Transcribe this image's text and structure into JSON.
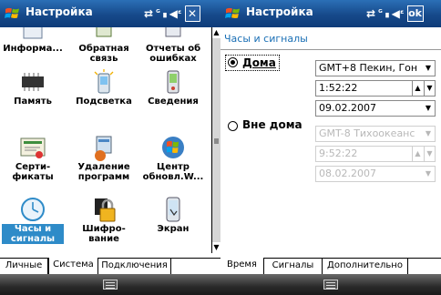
{
  "left": {
    "title": "Настройка",
    "items": [
      {
        "label": "Информа...",
        "icon": "info-icon"
      },
      {
        "label": "Обратная связь",
        "icon": "feedback-icon"
      },
      {
        "label": "Отчеты об ошибках",
        "icon": "error-report-icon"
      },
      {
        "label": "Память",
        "icon": "memory-chip-icon"
      },
      {
        "label": "Подсветка",
        "icon": "backlight-icon"
      },
      {
        "label": "Сведения",
        "icon": "device-info-icon"
      },
      {
        "label": "Серти-фикаты",
        "label_lines": [
          "Серти-",
          "фикаты"
        ],
        "icon": "certificate-icon"
      },
      {
        "label": "Удаление программ",
        "label_lines": [
          "Удаление",
          "программ"
        ],
        "icon": "remove-programs-icon"
      },
      {
        "label": "Центр обновл.W...",
        "label_lines": [
          "Центр",
          "обновл.W..."
        ],
        "icon": "windows-update-icon"
      },
      {
        "label": "Часы и сигналы",
        "label_lines": [
          "Часы и",
          "сигналы"
        ],
        "icon": "clock-icon",
        "selected": true
      },
      {
        "label": "Шифро-вание",
        "label_lines": [
          "Шифро-",
          "вание"
        ],
        "icon": "encryption-lock-icon"
      },
      {
        "label": "Экран",
        "icon": "screen-icon"
      }
    ],
    "tabs": [
      "Личные",
      "Система",
      "Подключения"
    ],
    "active_tab": "Система"
  },
  "right": {
    "title": "Настройка",
    "ok_label": "ok",
    "section": "Часы и сигналы",
    "home": {
      "label": "Дома",
      "selected": true,
      "timezone": "GMT+8 Пекин, Гон",
      "time": "1:52:22",
      "date": "09.02.2007"
    },
    "away": {
      "label": "Вне дома",
      "selected": false,
      "timezone": "GMT-8 Тихоокеанс",
      "time": "9:52:22",
      "date": "08.02.2007"
    },
    "tabs": [
      "Время",
      "Сигналы",
      "Дополнительно"
    ],
    "active_tab": "Время"
  },
  "colors": {
    "titlebar": "#16498a",
    "accent": "#2e8bc8",
    "section_text": "#1a6fb5"
  }
}
